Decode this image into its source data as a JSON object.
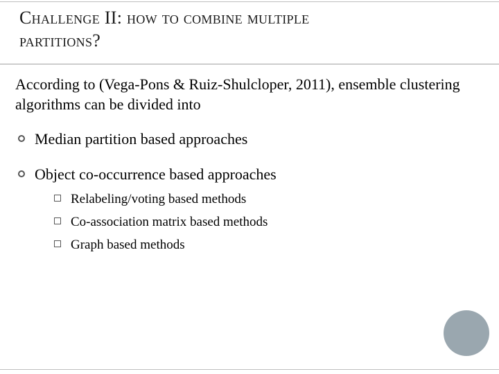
{
  "title": {
    "line1": "Challenge II: how to combine multiple",
    "line2": "partitions?"
  },
  "intro": "According to (Vega-Pons & Ruiz-Shulcloper, 2011), ensemble clustering algorithms can be divided into",
  "bullets": {
    "b1": "Median partition based approaches",
    "b2": "Object co-occurrence based approaches",
    "sub": {
      "s1": "Relabeling/voting based methods",
      "s2": "Co-association matrix based methods",
      "s3": "Graph based methods"
    }
  }
}
